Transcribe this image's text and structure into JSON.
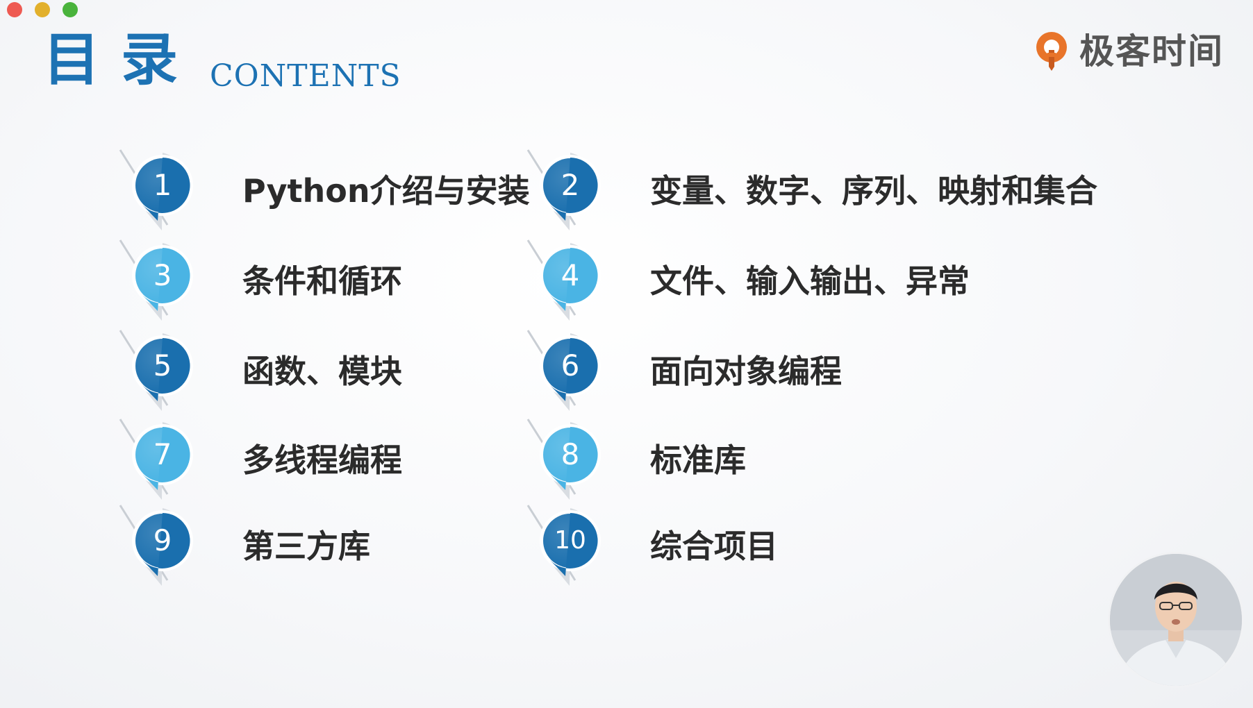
{
  "window": {
    "controls": [
      "close",
      "minimize",
      "maximize"
    ]
  },
  "slide": {
    "title_cn": "目录",
    "title_en": "CONTENTS",
    "brand": {
      "name": "极客时间",
      "icon": "geektime-logo-icon",
      "color": "#e8742a"
    },
    "accent_dark": "#1a6fae",
    "accent_light": "#4ab4e4",
    "items": [
      {
        "number": "1",
        "label": "Python介绍与安装",
        "style": "dark"
      },
      {
        "number": "2",
        "label": "变量、数字、序列、映射和集合",
        "style": "dark"
      },
      {
        "number": "3",
        "label": "条件和循环",
        "style": "light"
      },
      {
        "number": "4",
        "label": "文件、输入输出、异常",
        "style": "light"
      },
      {
        "number": "5",
        "label": "函数、模块",
        "style": "dark"
      },
      {
        "number": "6",
        "label": "面向对象编程",
        "style": "dark"
      },
      {
        "number": "7",
        "label": "多线程编程",
        "style": "light"
      },
      {
        "number": "8",
        "label": "标准库",
        "style": "light"
      },
      {
        "number": "9",
        "label": "第三方库",
        "style": "dark"
      },
      {
        "number": "10",
        "label": "综合项目",
        "style": "dark"
      }
    ]
  },
  "presenter": {
    "icon": "presenter-video-avatar"
  }
}
